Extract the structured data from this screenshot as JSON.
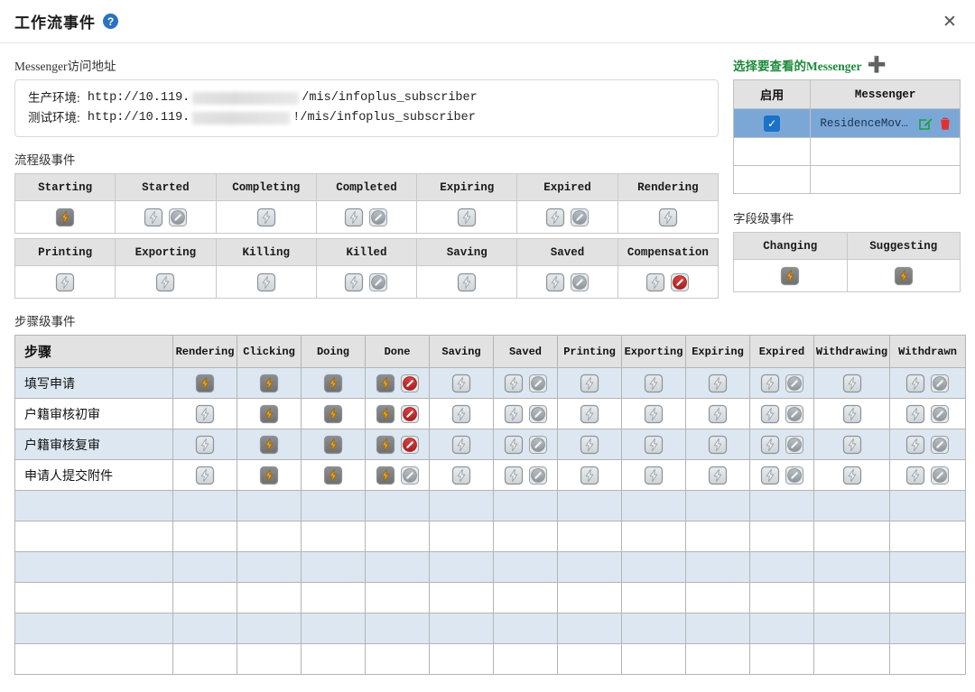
{
  "window": {
    "title": "工作流事件",
    "help_icon": "question-mark-icon",
    "close_icon": "close-icon"
  },
  "url_section": {
    "label": "Messenger访问地址",
    "rows": [
      {
        "env_label": "生产环境:",
        "prefix": "http://10.119.",
        "redacted": true,
        "suffix": "/mis/infoplus_subscriber"
      },
      {
        "env_label": "测试环境:",
        "prefix": "http://10.119.",
        "redacted": true,
        "suffix": "!/mis/infoplus_subscriber"
      }
    ]
  },
  "messenger_panel": {
    "header": "选择要查看的Messenger",
    "add_icon": "plus-icon",
    "columns": [
      "启用",
      "Messenger"
    ],
    "rows": [
      {
        "enabled": true,
        "name": "ResidenceMoveA…",
        "selected": true,
        "edit_icon": "edit-icon",
        "delete_icon": "trash-icon"
      },
      {
        "enabled": null,
        "name": "",
        "selected": false
      },
      {
        "enabled": null,
        "name": "",
        "selected": false
      }
    ]
  },
  "process_events": {
    "label": "流程级事件",
    "rows": [
      [
        {
          "name": "Starting",
          "bolt": "active",
          "block": "none"
        },
        {
          "name": "Started",
          "bolt": "inactive",
          "block": "gray"
        },
        {
          "name": "Completing",
          "bolt": "inactive",
          "block": "none"
        },
        {
          "name": "Completed",
          "bolt": "inactive",
          "block": "gray"
        },
        {
          "name": "Expiring",
          "bolt": "inactive",
          "block": "none"
        },
        {
          "name": "Expired",
          "bolt": "inactive",
          "block": "gray"
        },
        {
          "name": "Rendering",
          "bolt": "inactive",
          "block": "none"
        }
      ],
      [
        {
          "name": "Printing",
          "bolt": "inactive",
          "block": "none"
        },
        {
          "name": "Exporting",
          "bolt": "inactive",
          "block": "none"
        },
        {
          "name": "Killing",
          "bolt": "inactive",
          "block": "none"
        },
        {
          "name": "Killed",
          "bolt": "inactive",
          "block": "gray"
        },
        {
          "name": "Saving",
          "bolt": "inactive",
          "block": "none"
        },
        {
          "name": "Saved",
          "bolt": "inactive",
          "block": "gray"
        },
        {
          "name": "Compensation",
          "bolt": "inactive",
          "block": "red"
        }
      ]
    ]
  },
  "field_events": {
    "label": "字段级事件",
    "columns": [
      {
        "name": "Changing",
        "bolt": "active",
        "block": "none"
      },
      {
        "name": "Suggesting",
        "bolt": "active",
        "block": "none"
      }
    ]
  },
  "step_events": {
    "label": "步骤级事件",
    "columns": [
      "步骤",
      "Rendering",
      "Clicking",
      "Doing",
      "Done",
      "Saving",
      "Saved",
      "Printing",
      "Exporting",
      "Expiring",
      "Expired",
      "Withdrawing",
      "Withdrawn"
    ],
    "rows": [
      {
        "step": "填写申请",
        "cells": [
          {
            "bolt": "active",
            "block": "none"
          },
          {
            "bolt": "active",
            "block": "none"
          },
          {
            "bolt": "active",
            "block": "none"
          },
          {
            "bolt": "active",
            "block": "red"
          },
          {
            "bolt": "inactive",
            "block": "none"
          },
          {
            "bolt": "inactive",
            "block": "gray"
          },
          {
            "bolt": "inactive",
            "block": "none"
          },
          {
            "bolt": "inactive",
            "block": "none"
          },
          {
            "bolt": "inactive",
            "block": "none"
          },
          {
            "bolt": "inactive",
            "block": "gray"
          },
          {
            "bolt": "inactive",
            "block": "none"
          },
          {
            "bolt": "inactive",
            "block": "gray"
          }
        ]
      },
      {
        "step": "户籍审核初审",
        "cells": [
          {
            "bolt": "inactive",
            "block": "none"
          },
          {
            "bolt": "active",
            "block": "none"
          },
          {
            "bolt": "active",
            "block": "none"
          },
          {
            "bolt": "active",
            "block": "red"
          },
          {
            "bolt": "inactive",
            "block": "none"
          },
          {
            "bolt": "inactive",
            "block": "gray"
          },
          {
            "bolt": "inactive",
            "block": "none"
          },
          {
            "bolt": "inactive",
            "block": "none"
          },
          {
            "bolt": "inactive",
            "block": "none"
          },
          {
            "bolt": "inactive",
            "block": "gray"
          },
          {
            "bolt": "inactive",
            "block": "none"
          },
          {
            "bolt": "inactive",
            "block": "gray"
          }
        ]
      },
      {
        "step": "户籍审核复审",
        "cells": [
          {
            "bolt": "inactive",
            "block": "none"
          },
          {
            "bolt": "active",
            "block": "none"
          },
          {
            "bolt": "active",
            "block": "none"
          },
          {
            "bolt": "active",
            "block": "red"
          },
          {
            "bolt": "inactive",
            "block": "none"
          },
          {
            "bolt": "inactive",
            "block": "gray"
          },
          {
            "bolt": "inactive",
            "block": "none"
          },
          {
            "bolt": "inactive",
            "block": "none"
          },
          {
            "bolt": "inactive",
            "block": "none"
          },
          {
            "bolt": "inactive",
            "block": "gray"
          },
          {
            "bolt": "inactive",
            "block": "none"
          },
          {
            "bolt": "inactive",
            "block": "gray"
          }
        ]
      },
      {
        "step": "申请人提交附件",
        "cells": [
          {
            "bolt": "inactive",
            "block": "none"
          },
          {
            "bolt": "active",
            "block": "none"
          },
          {
            "bolt": "active",
            "block": "none"
          },
          {
            "bolt": "active",
            "block": "gray"
          },
          {
            "bolt": "inactive",
            "block": "none"
          },
          {
            "bolt": "inactive",
            "block": "gray"
          },
          {
            "bolt": "inactive",
            "block": "none"
          },
          {
            "bolt": "inactive",
            "block": "none"
          },
          {
            "bolt": "inactive",
            "block": "none"
          },
          {
            "bolt": "inactive",
            "block": "gray"
          },
          {
            "bolt": "inactive",
            "block": "none"
          },
          {
            "bolt": "inactive",
            "block": "gray"
          }
        ]
      },
      {
        "step": "",
        "cells": []
      },
      {
        "step": "",
        "cells": []
      },
      {
        "step": "",
        "cells": []
      },
      {
        "step": "",
        "cells": []
      },
      {
        "step": "",
        "cells": []
      },
      {
        "step": "",
        "cells": []
      }
    ]
  },
  "colors": {
    "bolt_active": "#f0a020",
    "bolt_inactive": "#b9bfc4",
    "block_red": "#c62828",
    "block_gray": "#9aa0a5",
    "selection_blue": "#7ba7d7",
    "row_alt_blue": "#dce7f1",
    "accent_green": "#1e8a3c",
    "accent_blue": "#2a72c4"
  }
}
